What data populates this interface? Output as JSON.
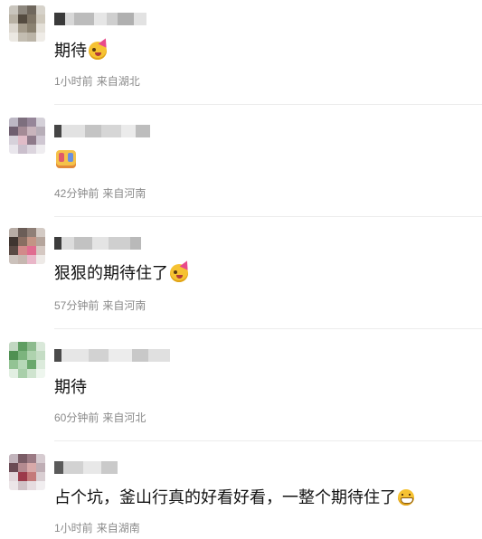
{
  "comments": [
    {
      "text": "期待",
      "emoji": "party-face-icon",
      "time": "1小时前",
      "location": "来自湖北"
    },
    {
      "text": "",
      "emoji": "clapper-icon",
      "time": "42分钟前",
      "location": "来自河南"
    },
    {
      "text": "狠狠的期待住了",
      "emoji": "party-face-icon",
      "time": "57分钟前",
      "location": "来自河南"
    },
    {
      "text": "期待",
      "emoji": "",
      "time": "60分钟前",
      "location": "来自河北"
    },
    {
      "text": "占个坑，釜山行真的好看好看，一整个期待住了",
      "emoji": "grin-face-icon",
      "time": "1小时前",
      "location": "来自湖南"
    }
  ]
}
